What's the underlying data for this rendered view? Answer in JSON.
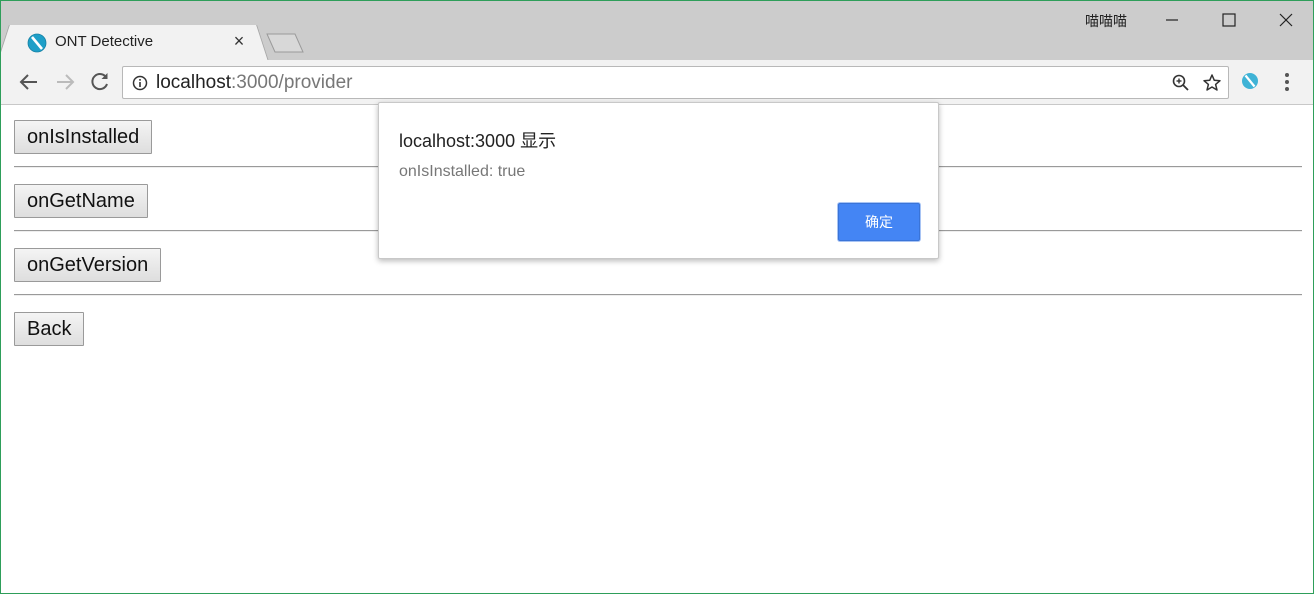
{
  "window": {
    "user_name": "喵喵喵",
    "frame_color": "#2e9e5a"
  },
  "tab": {
    "title": "ONT Detective",
    "favicon": "ont-logo-icon",
    "close_label": "×"
  },
  "toolbar": {
    "back_icon": "back-arrow-icon",
    "forward_icon": "forward-arrow-icon",
    "reload_icon": "reload-icon",
    "url_host": "localhost",
    "url_path": ":3000/provider",
    "zoom_icon": "zoom-icon",
    "bookmark_icon": "star-icon",
    "extension_icon": "ont-extension-icon",
    "menu_icon": "kebab-menu-icon"
  },
  "page": {
    "buttons": [
      {
        "label": "onIsInstalled"
      },
      {
        "label": "onGetName"
      },
      {
        "label": "onGetVersion"
      },
      {
        "label": "Back"
      }
    ]
  },
  "dialog": {
    "title": "localhost:3000 显示",
    "message": "onIsInstalled: true",
    "ok_label": "确定",
    "ok_color": "#4485f4"
  }
}
